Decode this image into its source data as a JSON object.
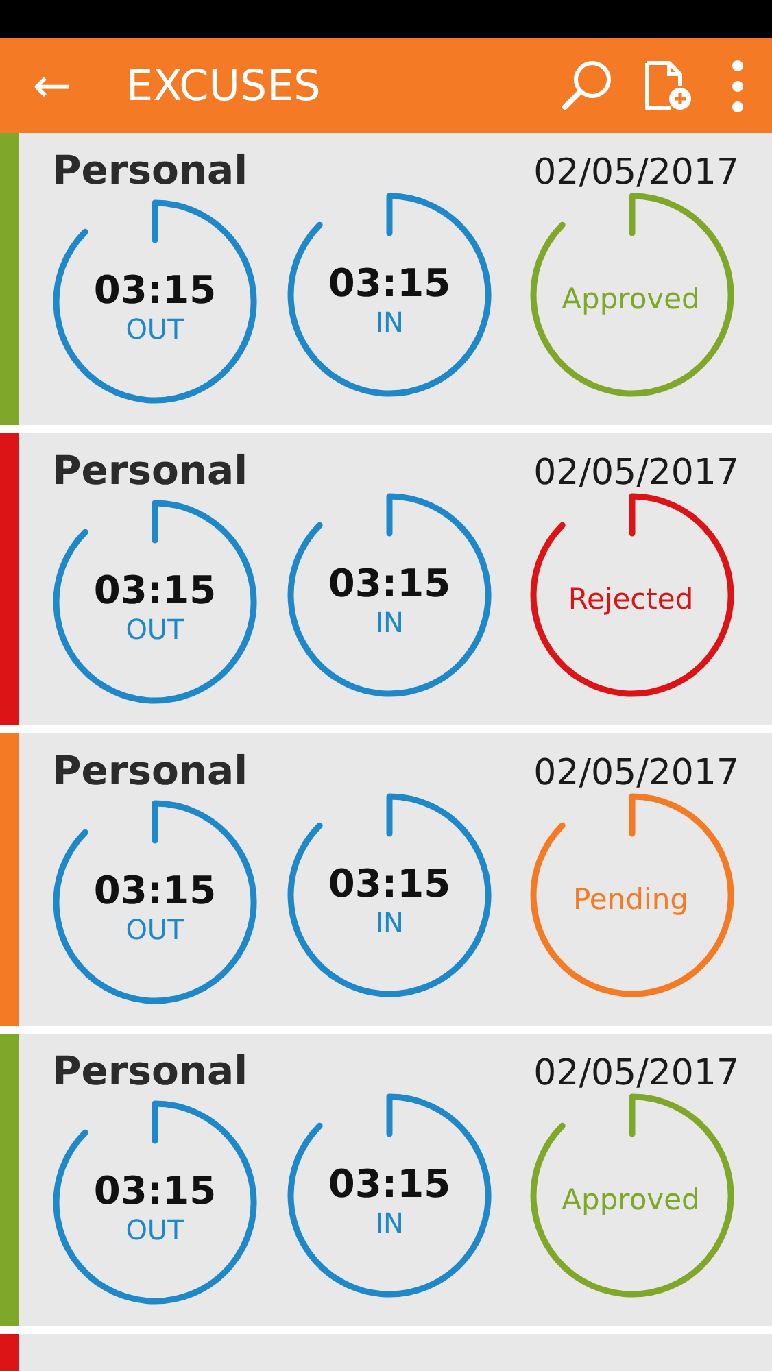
{
  "toolbar": {
    "back": "←",
    "title": "EXCUSES"
  },
  "excuses": [
    {
      "type": "Personal",
      "date": "02/05/2017",
      "color": "#7fa82a",
      "out": {
        "time": "03:15",
        "label": "OUT"
      },
      "in": {
        "time": "03:15",
        "label": "IN"
      },
      "status": "Approved"
    },
    {
      "type": "Personal",
      "date": "02/05/2017",
      "color": "#dd1416",
      "out": {
        "time": "03:15",
        "label": "OUT"
      },
      "in": {
        "time": "03:15",
        "label": "IN"
      },
      "status": "Rejected"
    },
    {
      "type": "Personal",
      "date": "02/05/2017",
      "color": "#f47a25",
      "out": {
        "time": "03:15",
        "label": "OUT"
      },
      "in": {
        "time": "03:15",
        "label": "IN"
      },
      "status": "Pending"
    },
    {
      "type": "Personal",
      "date": "02/05/2017",
      "color": "#7fa82a",
      "out": {
        "time": "03:15",
        "label": "OUT"
      },
      "in": {
        "time": "03:15",
        "label": "IN"
      },
      "status": "Approved"
    },
    {
      "color": "#dd1416"
    }
  ]
}
